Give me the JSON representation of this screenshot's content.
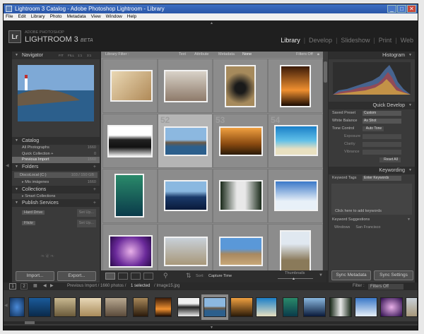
{
  "window": {
    "title": "Lightroom 3 Catalog - Adobe Photoshop Lightroom - Library"
  },
  "menu": [
    "File",
    "Edit",
    "Library",
    "Photo",
    "Metadata",
    "View",
    "Window",
    "Help"
  ],
  "brand": {
    "line1": "ADOBE PHOTOSHOP",
    "name": "LIGHTROOM 3",
    "beta": "BETA"
  },
  "modules": [
    "Library",
    "Develop",
    "Slideshow",
    "Print",
    "Web"
  ],
  "left": {
    "navigator": {
      "title": "Navigator",
      "zoom": [
        "FIT",
        "FILL",
        "1:1",
        "3:1"
      ]
    },
    "catalog": {
      "title": "Catalog",
      "items": [
        {
          "label": "All Photographs",
          "count": "1660"
        },
        {
          "label": "Quick Collection +",
          "count": "0"
        },
        {
          "label": "Previous Import",
          "count": "1660"
        }
      ]
    },
    "folders": {
      "title": "Folders",
      "disk": "DiscoLocal (C:)",
      "disk_size": "103 / 150 GB",
      "items": [
        {
          "label": "Mis imágenes",
          "count": "1660"
        }
      ]
    },
    "collections": {
      "title": "Collections",
      "items": [
        {
          "label": "Smart Collections"
        }
      ]
    },
    "publish": {
      "title": "Publish Services",
      "items": [
        {
          "label": "Hard Drive",
          "action": "Set Up..."
        },
        {
          "label": "Flickr",
          "action": "Set Up..."
        }
      ]
    },
    "import_label": "Import...",
    "export_label": "Export..."
  },
  "filter": {
    "title": "Library Filter :",
    "tabs": [
      "Text",
      "Attribute",
      "Metadata",
      "None"
    ],
    "status": "Filters Off"
  },
  "grid": {
    "numbers": [
      "",
      "",
      "",
      "",
      "52",
      "53",
      "54",
      "",
      "",
      "",
      "",
      "",
      "",
      "",
      "",
      ""
    ]
  },
  "toolbar": {
    "sort_label": "Sort:",
    "sort_value": "Capture Time",
    "thumbnails": "Thumbnails"
  },
  "right": {
    "histogram": "Histogram",
    "quick_develop": {
      "title": "Quick Develop",
      "saved_preset": {
        "label": "Saved Preset",
        "value": "Custom"
      },
      "white_balance": {
        "label": "White Balance",
        "value": "As Shot"
      },
      "tone_control": {
        "label": "Tone Control",
        "value": "Auto Tone"
      },
      "sliders": [
        "Exposure",
        "Clarity",
        "Vibrance"
      ],
      "reset": "Reset All"
    },
    "keywording": {
      "title": "Keywording",
      "tags_label": "Keyword Tags",
      "tags_value": "Enter Keywords",
      "click_hint": "Click here to add keywords",
      "suggestions_title": "Keyword Suggestions",
      "suggestions": [
        "Windows",
        "San Francisco"
      ]
    },
    "sync_metadata": "Sync Metadata",
    "sync_settings": "Sync Settings"
  },
  "filmstrip": {
    "pages": [
      "1",
      "2"
    ],
    "path": "Previous Import / 1660 photos /",
    "selected": "1 selected",
    "file": "/ Image15.jpg",
    "filter_label": "Filter :",
    "filter_value": "Filters Off"
  }
}
